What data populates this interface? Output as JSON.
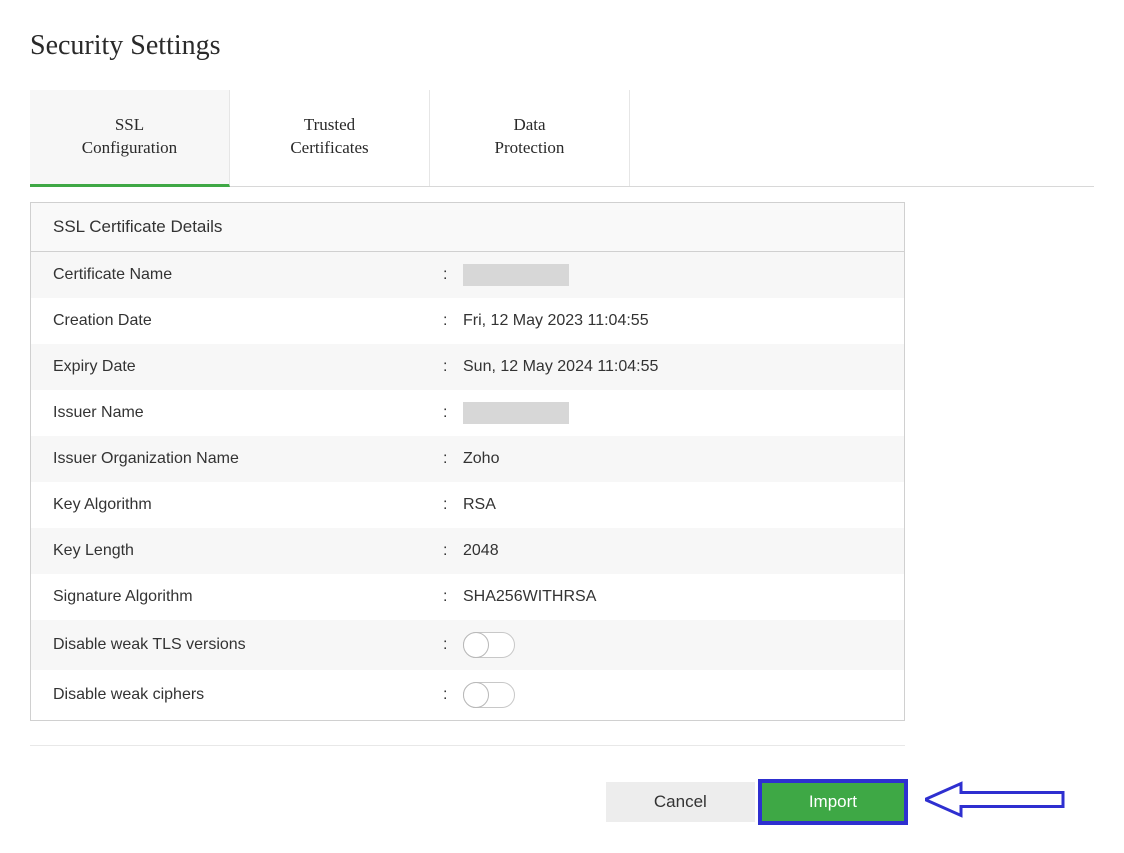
{
  "page": {
    "title": "Security Settings"
  },
  "tabs": [
    {
      "id": "ssl-configuration",
      "label": "SSL Configuration",
      "active": true
    },
    {
      "id": "trusted-certificates",
      "label": "Trusted Certificates",
      "active": false
    },
    {
      "id": "data-protection",
      "label": "Data Protection",
      "active": false
    }
  ],
  "panel": {
    "header": "SSL Certificate Details",
    "rows": [
      {
        "label": "Certificate Name",
        "value": "",
        "redacted": true,
        "type": "text"
      },
      {
        "label": "Creation Date",
        "value": "Fri, 12 May 2023 11:04:55",
        "type": "text"
      },
      {
        "label": "Expiry Date",
        "value": "Sun, 12 May 2024 11:04:55",
        "type": "text"
      },
      {
        "label": "Issuer Name",
        "value": "",
        "redacted": true,
        "type": "text"
      },
      {
        "label": "Issuer Organization Name",
        "value": "Zoho",
        "type": "text"
      },
      {
        "label": "Key Algorithm",
        "value": "RSA",
        "type": "text"
      },
      {
        "label": "Key Length",
        "value": "2048",
        "type": "text"
      },
      {
        "label": "Signature Algorithm",
        "value": "SHA256WITHRSA",
        "type": "text"
      },
      {
        "label": "Disable weak TLS versions",
        "value": false,
        "type": "toggle"
      },
      {
        "label": "Disable weak ciphers",
        "value": false,
        "type": "toggle"
      }
    ]
  },
  "actions": {
    "cancel_label": "Cancel",
    "import_label": "Import"
  },
  "annotation": {
    "arrow_color": "#2e2fd0"
  }
}
